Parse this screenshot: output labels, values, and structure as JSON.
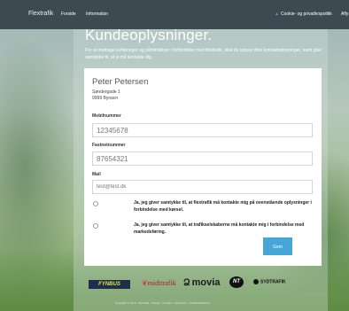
{
  "nav": {
    "brand": "Flextrafik",
    "items": [
      "Forside",
      "Information"
    ],
    "right_items": [
      "Cookie- og privatlivspolitik",
      "Afly"
    ]
  },
  "page": {
    "title": "Kundeoplysninger.",
    "intro": "For at modtage kvitteringer og påmindelser i forbindelse med flextrafik, skal du oplyse dine kontaktoplysninger, samt give samtykke til, at vi må kontakte dig."
  },
  "customer": {
    "name": "Peter Petersen",
    "street": "Søndergade 1",
    "city": "9999 Bynavn"
  },
  "form": {
    "mobile": {
      "label": "Mobilnummer",
      "value": "12345678"
    },
    "landline": {
      "label": "Fastnetnummer",
      "value": "87654321"
    },
    "mail": {
      "label": "Mail",
      "value": "test@test.dk"
    },
    "consent1": "Ja, jeg giver samtykke til, at flextrafik må kontakte mig på ovenstående oplysninger i forbindelse med kørsel.",
    "consent2": "Ja, jeg giver samtykke til, at trafikselskaberne må kontakte mig i forbindelse med markedsføring.",
    "save_label": "Gem"
  },
  "logos": {
    "fynbus": "FYNBUS",
    "midttrafik": "midttrafik",
    "movia": "movia",
    "nt": "NT",
    "sydtrafik": "SYDTRAFIK"
  },
  "footer": "Copyright © 2014 · Flextrafik · Privacy · Kontakt · Information · Trafikselskaberne"
}
